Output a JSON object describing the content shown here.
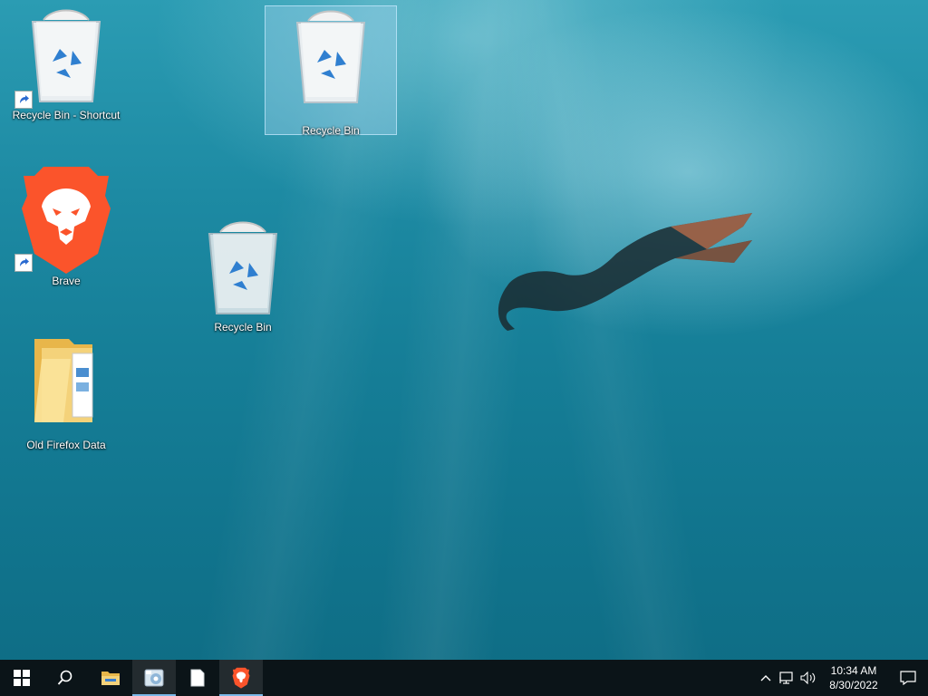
{
  "desktop": {
    "icons": [
      {
        "label": "Recycle Bin - Shortcut",
        "icon": "recycle-bin-icon",
        "shortcut": true
      },
      {
        "label": "Recycle Bin",
        "icon": "recycle-bin-icon",
        "selected": true
      },
      {
        "label": "Brave",
        "icon": "brave-lion-icon",
        "shortcut": true
      },
      {
        "label": "Recycle Bin",
        "icon": "recycle-bin-icon"
      },
      {
        "label": "Old Firefox Data",
        "icon": "folder-icon"
      }
    ]
  },
  "taskbar": {
    "buttons": [
      {
        "icon": "windows-start-icon"
      },
      {
        "icon": "search-icon"
      },
      {
        "icon": "file-explorer-icon"
      },
      {
        "icon": "media-app-icon",
        "active": true
      },
      {
        "icon": "blank-document-icon"
      },
      {
        "icon": "brave-lion-icon",
        "active": true
      }
    ],
    "tray": {
      "time": "10:34 AM",
      "date": "8/30/2022"
    }
  },
  "colors": {
    "taskbar_bg": "#0b1418",
    "active_underline": "#7ab8e8",
    "brave_orange": "#fb542b"
  }
}
